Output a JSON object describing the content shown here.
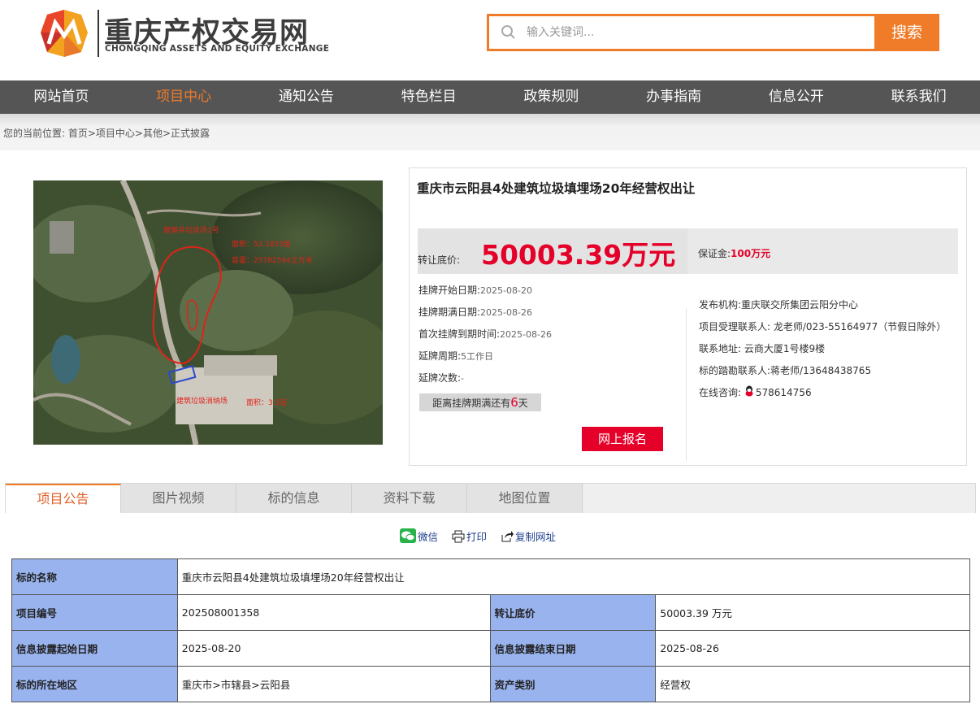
{
  "header": {
    "logo_cn": "重庆产权交易网",
    "logo_en": "CHONGQING ASSETS AND EQUITY EXCHANGE",
    "search_placeholder": "输入关键词...",
    "search_button": "搜索"
  },
  "nav": {
    "items": [
      "网站首页",
      "项目中心",
      "通知公告",
      "特色栏目",
      "政策规则",
      "办事指南",
      "信息公开",
      "联系我们"
    ],
    "active_index": 1
  },
  "breadcrumb": {
    "prefix": "您的当前位置: ",
    "path": "首页>项目中心>其他>正式披露"
  },
  "project": {
    "title": "重庆市云阳县4处建筑垃圾填埋场20年经营权出让",
    "price_label": "转让底价:",
    "price_value": "50003.39万元",
    "deposit_label": "保证金:",
    "deposit_value": "100万元",
    "listing": [
      {
        "label": "挂牌开始日期:",
        "value": "2025-08-20"
      },
      {
        "label": "挂牌期满日期:",
        "value": "2025-08-26"
      },
      {
        "label": "首次挂牌到期时间:",
        "value": "2025-08-26"
      },
      {
        "label": "延牌周期:",
        "value": "5工作日"
      },
      {
        "label": "延牌次数:",
        "value": "-"
      }
    ],
    "countdown_prefix": "距离挂牌期满还有",
    "countdown_days": "6",
    "countdown_suffix": "天",
    "signup_button": "网上报名",
    "contacts": [
      {
        "label": "发布机构:",
        "value": "重庆联交所集团云阳分中心"
      },
      {
        "label": "项目受理联系人:",
        "value": " 龙老师/023-55164977（节假日除外）"
      },
      {
        "label": "联系地址:",
        "value": " 云商大厦1号楼9楼"
      },
      {
        "label": "标的踏勘联系人:",
        "value": "蒋老师/13648438765"
      }
    ],
    "consult_label": "在线咨询:",
    "consult_qq": "578614756"
  },
  "photo": {
    "labels": [
      "貔貅井垃圾场1号",
      "面积：52.1833亩",
      "容量：25782594立方米",
      "建筑垃圾消纳场",
      "面积：3.5亩"
    ]
  },
  "tabs": [
    "项目公告",
    "图片视频",
    "标的信息",
    "资料下载",
    "地图位置"
  ],
  "share": {
    "wechat": "微信",
    "print": "打印",
    "copy": "复制网址"
  },
  "detail_table": {
    "name_key": "标的名称",
    "name_value": "重庆市云阳县4处建筑垃圾填埋场20年经营权出让",
    "rows": [
      [
        "项目编号",
        "202508001358",
        "转让底价",
        "50003.39 万元"
      ],
      [
        "信息披露起始日期",
        "2025-08-20",
        "信息披露结束日期",
        "2025-08-26"
      ],
      [
        "标的所在地区",
        "重庆市>市辖县>云阳县",
        "资产类别",
        "经营权"
      ]
    ]
  },
  "colors": {
    "accent": "#f07b28",
    "price_red": "#e5002a",
    "nav_bg": "#555555",
    "table_key_bg": "#99b3ee"
  }
}
